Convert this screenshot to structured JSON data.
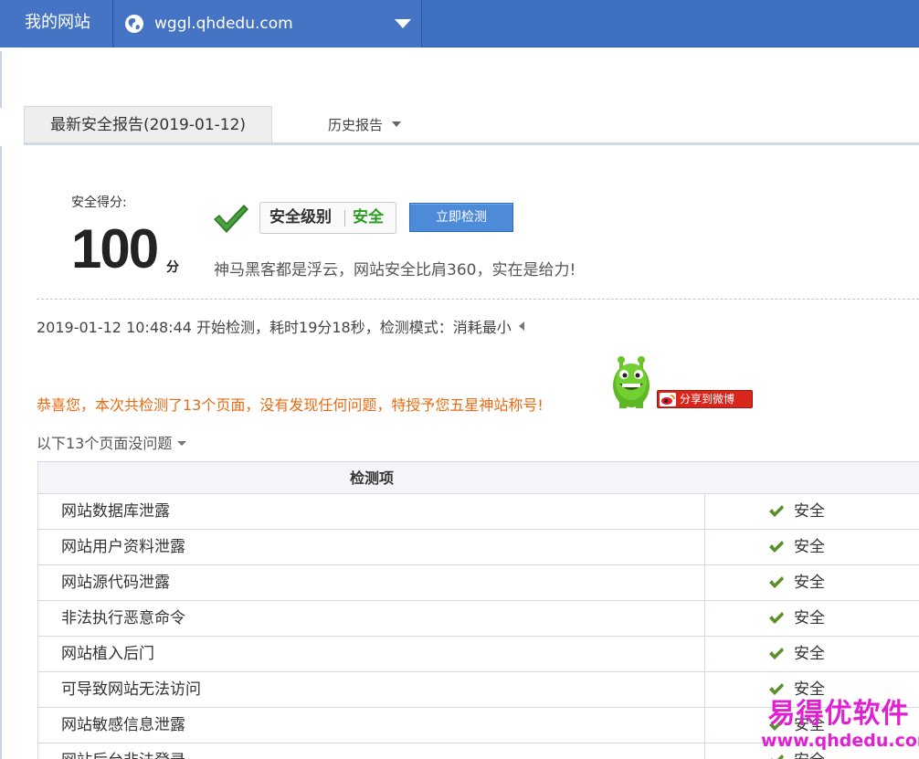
{
  "topbar": {
    "home_label": "我的网站",
    "site_url": "wggl.qhdedu.com"
  },
  "tabs": {
    "latest_report": "最新安全报告(2019-01-12)",
    "history_report": "历史报告"
  },
  "score": {
    "label": "安全得分:",
    "value": "100",
    "unit": "分"
  },
  "level": {
    "label": "安全级别",
    "value": "安全"
  },
  "scan_button": "立即检测",
  "slogan": "神马黑客都是浮云，网站安全比肩360，实在是给力!",
  "scan_info": "2019-01-12 10:48:44 开始检测，耗时19分18秒，检测模式：消耗最小",
  "congrats": "恭喜您，本次共检测了13个页面，没有发现任何问题，特授予您五星神站称号!",
  "share_weibo": "分享到微博",
  "no_issue_list": "以下13个页面没问题",
  "table": {
    "header": "检测项",
    "rows": [
      {
        "name": "网站数据库泄露",
        "status": "安全"
      },
      {
        "name": "网站用户资料泄露",
        "status": "安全"
      },
      {
        "name": "网站源代码泄露",
        "status": "安全"
      },
      {
        "name": "非法执行恶意命令",
        "status": "安全"
      },
      {
        "name": "网站植入后门",
        "status": "安全"
      },
      {
        "name": "可导致网站无法访问",
        "status": "安全"
      },
      {
        "name": "网站敏感信息泄露",
        "status": "安全"
      },
      {
        "name": "网站后台非法登录",
        "status": "安全"
      }
    ]
  },
  "watermark": {
    "title": "易得优软件",
    "url": "www.qhdedu.com"
  },
  "colors": {
    "topbar": "#3f6fc0",
    "safe_green": "#2a9b1e",
    "congrats_orange": "#e96a12",
    "watermark_magenta": "#e020d2"
  },
  "icons": {
    "globe": "globe-icon",
    "check": "check-icon",
    "mascot": "mascot-icon",
    "weibo": "weibo-icon"
  }
}
